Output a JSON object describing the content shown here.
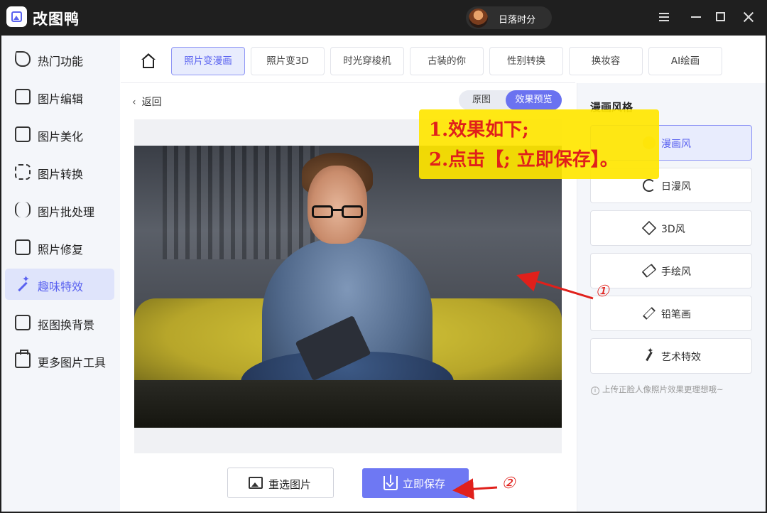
{
  "app": {
    "title": "改图鸭"
  },
  "user": {
    "name": "日落时分"
  },
  "window_controls": [
    "menu-icon",
    "minimize-icon",
    "maximize-icon",
    "close-icon"
  ],
  "sidebar": {
    "items": [
      {
        "label": "热门功能",
        "icon": "flame-icon",
        "active": false
      },
      {
        "label": "图片编辑",
        "icon": "image-edit-icon",
        "active": false
      },
      {
        "label": "图片美化",
        "icon": "image-beautify-icon",
        "active": false
      },
      {
        "label": "图片转换",
        "icon": "convert-icon",
        "active": false
      },
      {
        "label": "图片批处理",
        "icon": "batch-icon",
        "active": false
      },
      {
        "label": "照片修复",
        "icon": "photo-repair-icon",
        "active": false
      },
      {
        "label": "趣味特效",
        "icon": "magic-wand-icon",
        "active": true
      },
      {
        "label": "抠图换背景",
        "icon": "cutout-icon",
        "active": false
      },
      {
        "label": "更多图片工具",
        "icon": "toolbox-icon",
        "active": false
      }
    ]
  },
  "tabs": [
    {
      "label": "照片变漫画",
      "active": true
    },
    {
      "label": "照片变3D",
      "active": false
    },
    {
      "label": "时光穿梭机",
      "active": false
    },
    {
      "label": "古装的你",
      "active": false
    },
    {
      "label": "性别转换",
      "active": false
    },
    {
      "label": "换妆容",
      "active": false
    },
    {
      "label": "AI绘画",
      "active": false
    }
  ],
  "back_label": "返回",
  "view_toggle": {
    "original": "原图",
    "preview": "效果预览",
    "selected": "preview"
  },
  "right_panel": {
    "title": "漫画风格",
    "styles": [
      {
        "label": "漫画风",
        "icon": "bear-icon",
        "active": true
      },
      {
        "label": "日漫风",
        "icon": "swirl-icon",
        "active": false
      },
      {
        "label": "3D风",
        "icon": "cube-icon",
        "active": false
      },
      {
        "label": "手绘风",
        "icon": "eraser-icon",
        "active": false
      },
      {
        "label": "铅笔画",
        "icon": "pencil-icon",
        "active": false
      },
      {
        "label": "艺术特效",
        "icon": "magic-wand-icon",
        "active": false
      }
    ],
    "hint": "上传正脸人像照片效果更理想哦~"
  },
  "buttons": {
    "reselect": "重选图片",
    "save": "立即保存"
  },
  "annotation": {
    "line1": "1.效果如下;",
    "line2": "2.点击【; 立即保存】。",
    "marker1": "①",
    "marker2": "②"
  },
  "colors": {
    "accent": "#6e78f3",
    "titlebar": "#1f1f1f",
    "annotation_red": "#e0201b",
    "annotation_yellow": "#ffe600"
  }
}
